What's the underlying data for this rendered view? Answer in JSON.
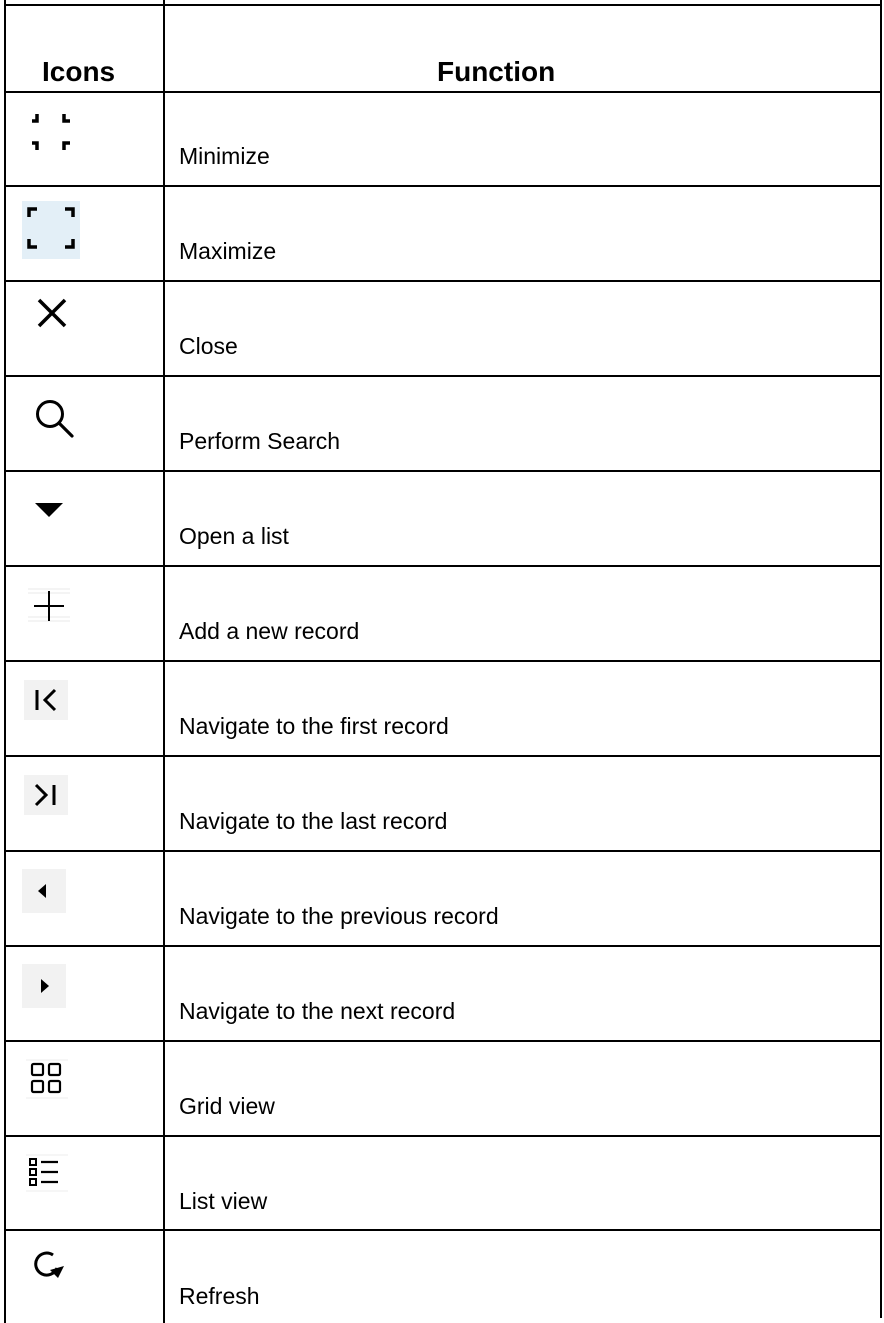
{
  "table": {
    "header": {
      "icons": "Icons",
      "function": "Function"
    },
    "rows": [
      {
        "icon": "minimize-icon",
        "label": "Minimize"
      },
      {
        "icon": "maximize-icon",
        "label": "Maximize"
      },
      {
        "icon": "close-icon",
        "label": "Close"
      },
      {
        "icon": "search-icon",
        "label": "Perform Search"
      },
      {
        "icon": "dropdown-arrow-icon",
        "label": "Open a list"
      },
      {
        "icon": "plus-icon",
        "label": "Add a new record"
      },
      {
        "icon": "first-record-icon",
        "label": "Navigate to the first record"
      },
      {
        "icon": "last-record-icon",
        "label": "Navigate to the last record"
      },
      {
        "icon": "previous-record-icon",
        "label": "Navigate to the previous record"
      },
      {
        "icon": "next-record-icon",
        "label": "Navigate to the next record"
      },
      {
        "icon": "grid-view-icon",
        "label": "Grid view"
      },
      {
        "icon": "list-view-icon",
        "label": "List view"
      },
      {
        "icon": "refresh-icon",
        "label": "Refresh"
      }
    ]
  },
  "colors": {
    "border": "#000000",
    "maximize_icon_bg": "#e3eff7",
    "nav_icon_bg": "#f2f2f2"
  }
}
